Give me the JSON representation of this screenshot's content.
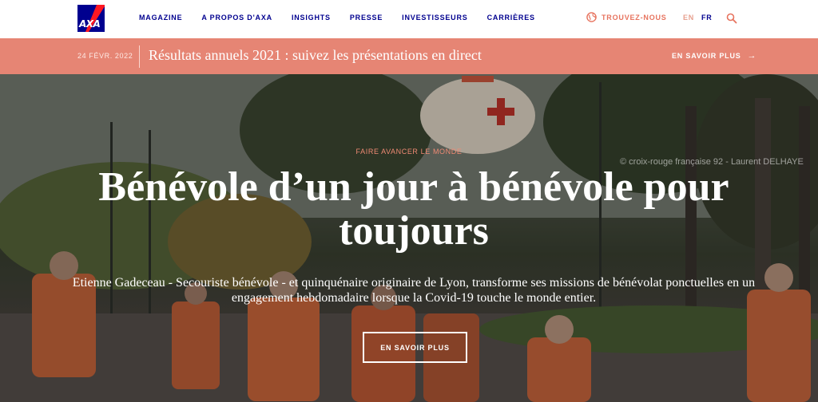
{
  "header": {
    "logo_text": "AXA",
    "nav": [
      "MAGAZINE",
      "A PROPOS D'AXA",
      "INSIGHTS",
      "PRESSE",
      "INVESTISSEURS",
      "CARRIÈRES"
    ],
    "find_us": "TROUVEZ-NOUS",
    "lang_en": "EN",
    "lang_fr": "FR"
  },
  "banner": {
    "date": "24 FÉVR. 2022",
    "title": "Résultats annuels 2021 : suivez les présentations en direct",
    "cta": "EN SAVOIR PLUS"
  },
  "hero": {
    "credit": "© croix-rouge française 92 - Laurent DELHAYE",
    "eyebrow": "FAIRE AVANCER LE MONDE",
    "title": "Bénévole d’un jour à bénévole pour toujours",
    "description": "Etienne Gadeceau - Secouriste bénévole - et quinquénaire originaire de Lyon, transforme ses missions de bénévolat ponctuelles en un engagement hebdomadaire lorsque la Covid-19 touche le monde entier.",
    "cta": "EN SAVOIR PLUS"
  },
  "colors": {
    "brand_blue": "#00008f",
    "accent_coral": "#e68574"
  },
  "icons": [
    "globe-icon",
    "search-icon",
    "arrow-right-icon"
  ]
}
